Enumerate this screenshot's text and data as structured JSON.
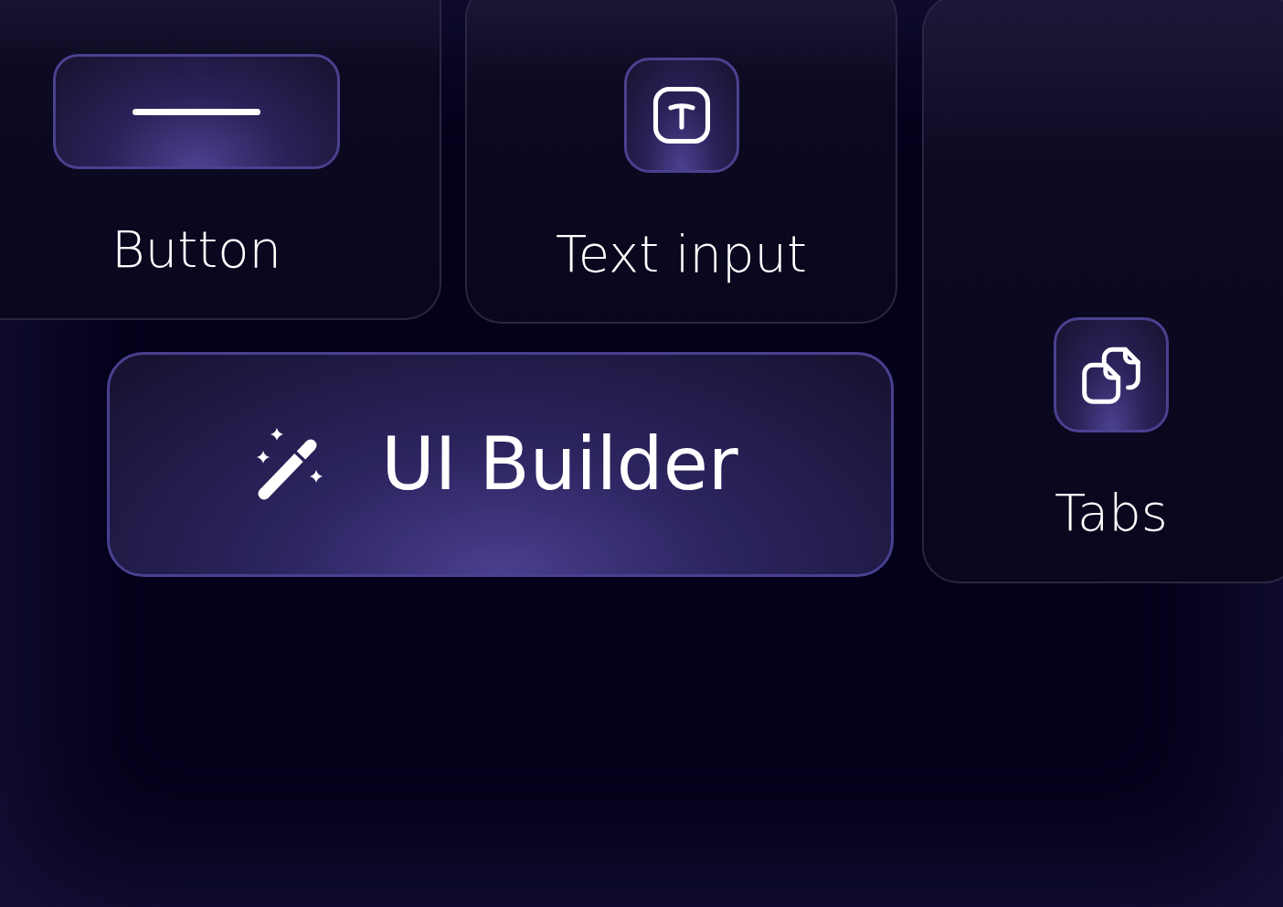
{
  "cards": [
    {
      "kind": "button",
      "label": "Button"
    },
    {
      "kind": "text_input",
      "label": "Text input"
    },
    {
      "kind": "tabs",
      "label": "Tabs"
    }
  ],
  "banner": {
    "label": "UI Builder"
  }
}
